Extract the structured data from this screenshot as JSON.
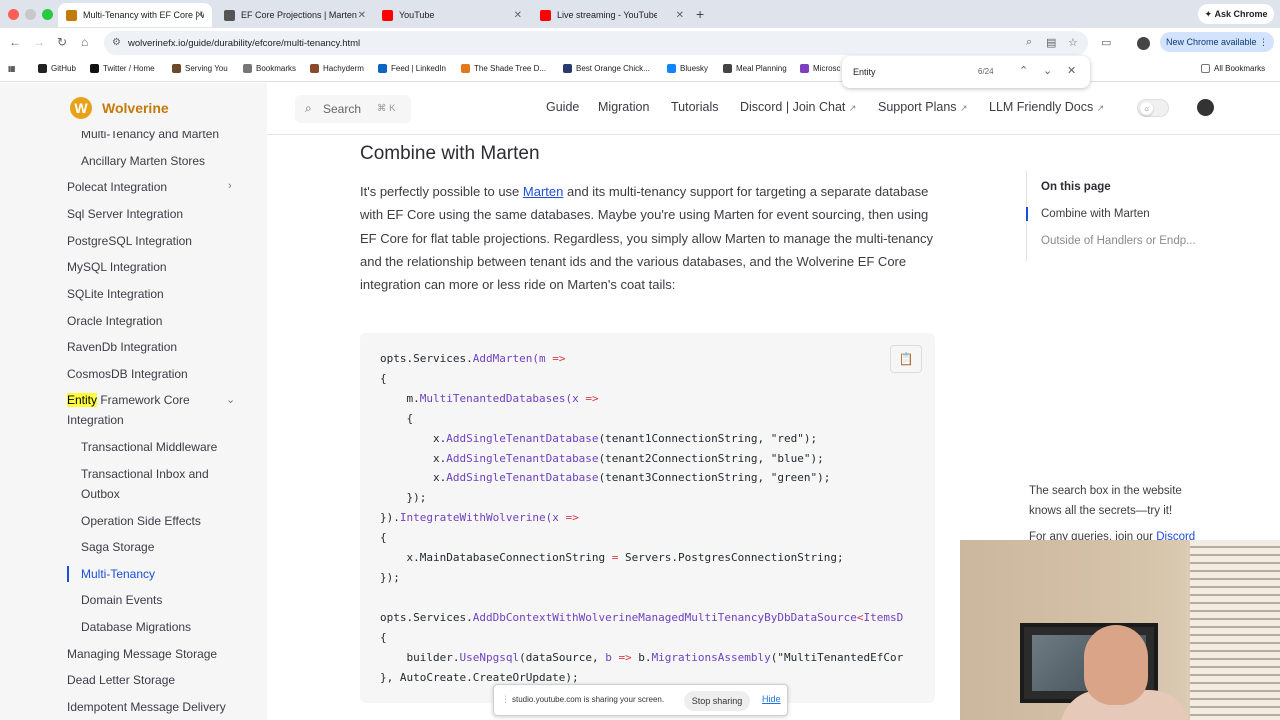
{
  "tabs": [
    {
      "label": "Multi-Tenancy with EF Core | Wolv",
      "favicon_color": "#c47a08"
    },
    {
      "label": "EF Core Projections | Marten",
      "favicon_color": "#555555"
    },
    {
      "label": "YouTube",
      "favicon_color": "#ff0000"
    },
    {
      "label": "Live streaming - YouTube Stu...",
      "favicon_color": "#ff0000"
    }
  ],
  "ask_chrome": "Ask Chrome",
  "url": "wolverinefx.io/guide/durability/efcore/multi-tenancy.html",
  "new_chrome": "New Chrome available",
  "bookmarks": [
    "GitHub",
    "Twitter / Home",
    "Serving You",
    "Bookmarks",
    "Hachyderm",
    "Feed | LinkedIn",
    "The Shade Tree D...",
    "Best Orange Chick...",
    "Bluesky",
    "Meal Planning",
    "Microsc"
  ],
  "all_bookmarks": "All Bookmarks",
  "find": {
    "query": "Entity",
    "count": "6/24"
  },
  "brand": "Wolverine",
  "search": {
    "label": "Search",
    "shortcut": "⌘ K"
  },
  "nav": [
    "Guide",
    "Migration",
    "Tutorials",
    "Discord | Join Chat",
    "Support Plans",
    "LLM Friendly Docs"
  ],
  "sidebar": {
    "cut_item": "Multi-Tenancy and Marten",
    "items": [
      "Ancillary Marten Stores",
      "Polecat Integration",
      "Sql Server Integration",
      "PostgreSQL Integration",
      "MySQL Integration",
      "SQLite Integration",
      "Oracle Integration",
      "RavenDb Integration",
      "CosmosDB Integration"
    ],
    "ef_highlight": "Entity",
    "ef_rest": " Framework Core",
    "ef_line2": "Integration",
    "sub_items": [
      "Transactional Middleware",
      "Transactional Inbox and",
      "Outbox",
      "Operation Side Effects",
      "Saga Storage",
      "Multi-Tenancy",
      "Domain Events",
      "Database Migrations"
    ],
    "bottom_items": [
      "Managing Message Storage",
      "Dead Letter Storage",
      "Idempotent Message Delivery"
    ]
  },
  "heading": "Combine with Marten",
  "para": {
    "pre": "It's perfectly possible to use ",
    "link": "Marten",
    "post": " and its multi-tenancy support for targeting a separate database with EF Core using the same databases. Maybe you're using Marten for event sourcing, then using EF Core for flat table projections. Regardless, you simply allow Marten to manage the multi-tenancy and the relationship between tenant ids and the various databases, and the Wolverine EF Core integration can more or less ride on Marten's coat tails:"
  },
  "toc": {
    "title": "On this page",
    "items": [
      "Combine with Marten",
      "Outside of Handlers or Endp..."
    ]
  },
  "ad": {
    "line": "The search box in the website knows all the secrets—try it!",
    "line2_pre": "For any queries, join our ",
    "line2_link": "Discord"
  },
  "share": {
    "text": "studio.youtube.com is sharing your screen.",
    "stop": "Stop sharing",
    "hide": "Hide"
  }
}
